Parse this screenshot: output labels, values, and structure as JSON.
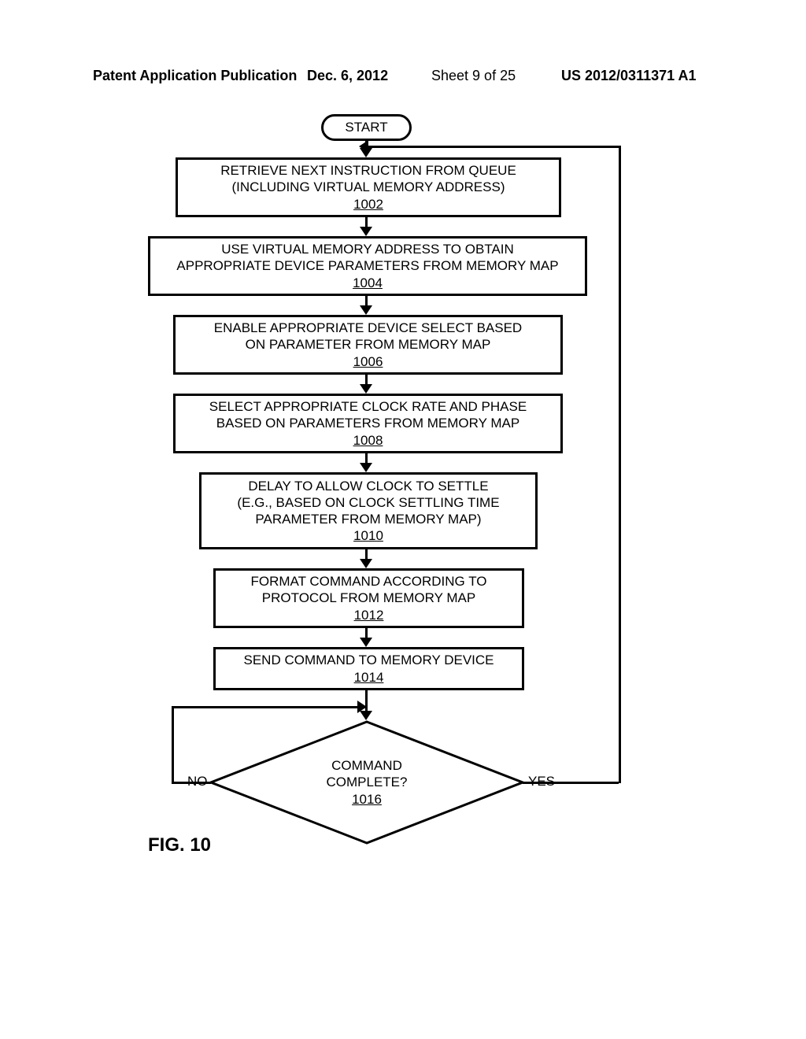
{
  "header": {
    "left": "Patent Application Publication",
    "date": "Dec. 6, 2012",
    "sheet": "Sheet 9 of 25",
    "pub": "US 2012/0311371 A1"
  },
  "start": "START",
  "boxes": {
    "b1002": {
      "l1": "RETRIEVE NEXT INSTRUCTION FROM QUEUE",
      "l2": "(INCLUDING VIRTUAL MEMORY ADDRESS)",
      "ref": "1002"
    },
    "b1004": {
      "l1": "USE VIRTUAL MEMORY ADDRESS TO OBTAIN",
      "l2": "APPROPRIATE DEVICE PARAMETERS FROM MEMORY MAP",
      "ref": "1004"
    },
    "b1006": {
      "l1": "ENABLE APPROPRIATE DEVICE SELECT BASED",
      "l2": "ON PARAMETER FROM MEMORY MAP",
      "ref": "1006"
    },
    "b1008": {
      "l1": "SELECT APPROPRIATE CLOCK RATE AND PHASE",
      "l2": "BASED ON PARAMETERS FROM MEMORY MAP",
      "ref": "1008"
    },
    "b1010": {
      "l1": "DELAY TO ALLOW CLOCK TO SETTLE",
      "l2": "(E.G., BASED ON CLOCK SETTLING TIME",
      "l3": "PARAMETER FROM MEMORY MAP)",
      "ref": "1010"
    },
    "b1012": {
      "l1": "FORMAT COMMAND ACCORDING TO",
      "l2": "PROTOCOL FROM MEMORY MAP",
      "ref": "1012"
    },
    "b1014": {
      "l1": "SEND COMMAND TO MEMORY DEVICE",
      "ref": "1014"
    }
  },
  "decision": {
    "l1": "COMMAND",
    "l2": "COMPLETE?",
    "ref": "1016"
  },
  "labels": {
    "no": "NO",
    "yes": "YES"
  },
  "fig": "FIG. 10"
}
